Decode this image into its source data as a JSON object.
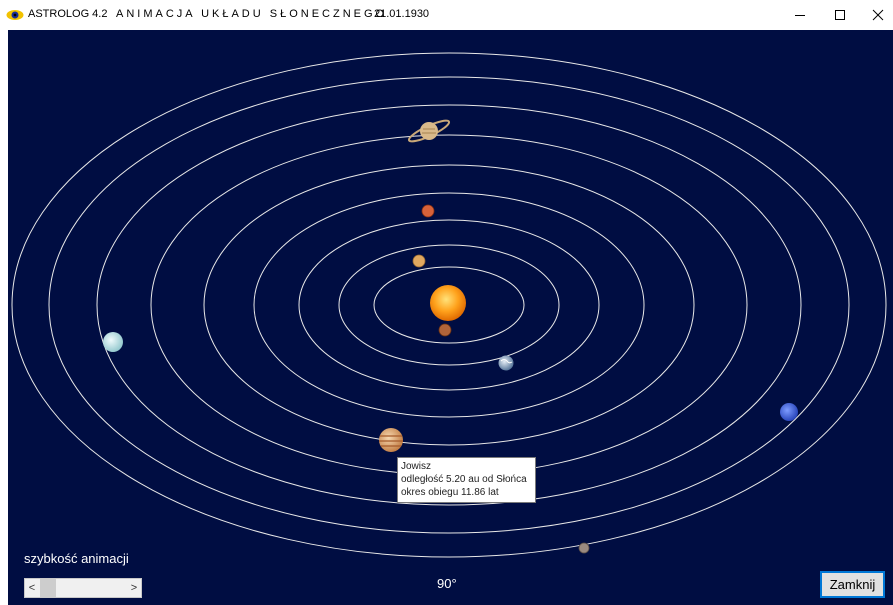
{
  "window": {
    "app_name": "ASTROLOG 4.2",
    "title": "ANIMACJA UKŁADU SŁONECZNEGO",
    "date": "21.01.1930",
    "controls": [
      "minimize-icon",
      "maximize-icon",
      "close-icon"
    ]
  },
  "space": {
    "background_color": "#000d42",
    "orbit_color": "#e8e8e8",
    "bodies": [
      {
        "name": "sun-icon",
        "color": "#ff9c1a"
      },
      {
        "name": "mercury-icon",
        "color": "#b0643a"
      },
      {
        "name": "venus-icon",
        "color": "#e0a860"
      },
      {
        "name": "earth-icon",
        "color": "#6b88a8"
      },
      {
        "name": "mars-icon",
        "color": "#d7623a"
      },
      {
        "name": "jupiter-icon",
        "color": "#e0a26a"
      },
      {
        "name": "saturn-icon",
        "color": "#cfae7e"
      },
      {
        "name": "uranus-icon",
        "color": "#bfe6ea"
      },
      {
        "name": "neptune-icon",
        "color": "#3b5ed8"
      },
      {
        "name": "pluto-icon",
        "color": "#9a8a80"
      }
    ]
  },
  "tooltip": {
    "planet": "Jowisz",
    "distance": "odległość 5.20 au od Słońca",
    "period": "okres obiegu 11.86 lat"
  },
  "controls": {
    "speed_label": "szybkość animacji",
    "scroll_left": "<",
    "scroll_right": ">",
    "angle": "90°",
    "close_button": "Zamknij"
  }
}
